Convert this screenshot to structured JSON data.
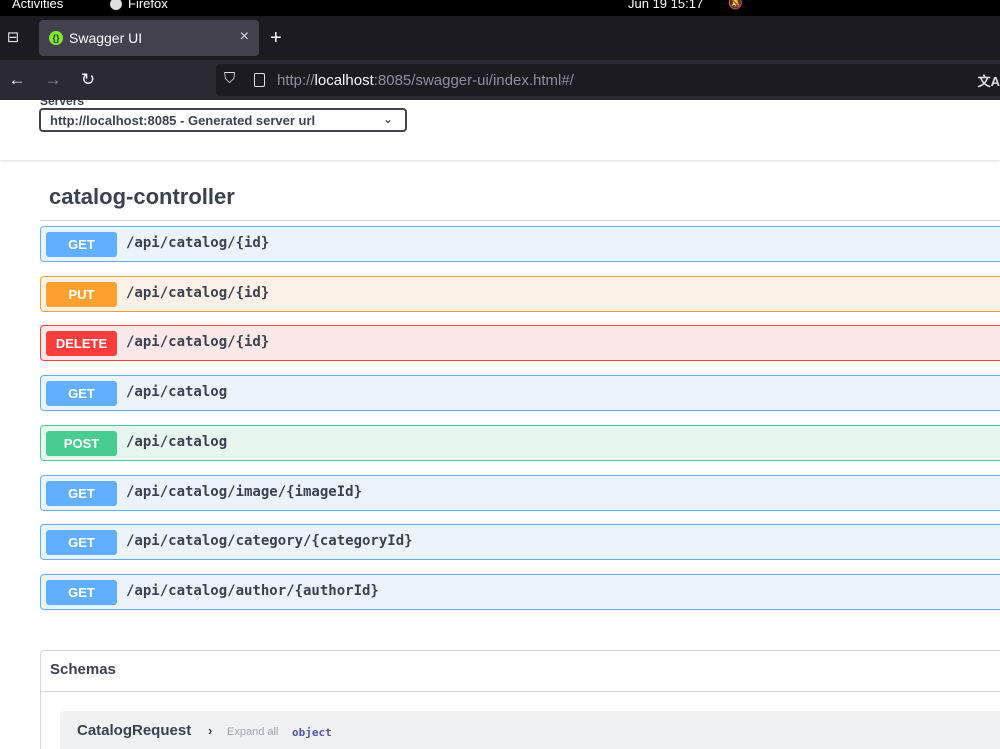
{
  "system_bar": {
    "activities": "Activities",
    "app_name": "Firefox",
    "clock": "Jun 19  15:17"
  },
  "browser": {
    "tab": {
      "title": "Swagger UI",
      "close": "×"
    },
    "new_tab": "+",
    "nav": {
      "back": "←",
      "forward": "→",
      "reload": "↻"
    },
    "url": {
      "scheme": "http://",
      "host": "localhost",
      "rest": ":8085/swagger-ui/index.html#/"
    }
  },
  "servers": {
    "label": "Servers",
    "selected": "http://localhost:8085 - Generated server url"
  },
  "tag": {
    "title": "catalog-controller"
  },
  "operations": [
    {
      "method": "GET",
      "path": "/api/catalog/{id}"
    },
    {
      "method": "PUT",
      "path": "/api/catalog/{id}"
    },
    {
      "method": "DELETE",
      "path": "/api/catalog/{id}"
    },
    {
      "method": "GET",
      "path": "/api/catalog"
    },
    {
      "method": "POST",
      "path": "/api/catalog"
    },
    {
      "method": "GET",
      "path": "/api/catalog/image/{imageId}"
    },
    {
      "method": "GET",
      "path": "/api/catalog/category/{categoryId}"
    },
    {
      "method": "GET",
      "path": "/api/catalog/author/{authorId}"
    }
  ],
  "schemas": {
    "title": "Schemas",
    "models": [
      {
        "name": "CatalogRequest",
        "expand_all": "Expand all",
        "type": "object"
      }
    ]
  },
  "colors": {
    "get": "#61affe",
    "put": "#fca130",
    "delete": "#f93e3e",
    "post": "#49cc90",
    "text": "#3b4151"
  }
}
